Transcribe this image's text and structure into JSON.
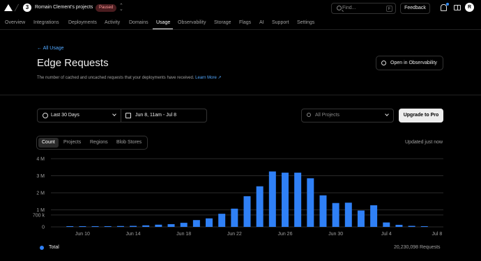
{
  "header": {
    "team_avatar": "3",
    "team_name": "Romain Clement's projects",
    "status_badge": "Paused",
    "search_placeholder": "Find...",
    "search_kbd": "F",
    "feedback_label": "Feedback",
    "user_initial": "R"
  },
  "tabs": [
    "Overview",
    "Integrations",
    "Deployments",
    "Activity",
    "Domains",
    "Usage",
    "Observability",
    "Storage",
    "Flags",
    "AI",
    "Support",
    "Settings"
  ],
  "active_tab": "Usage",
  "page": {
    "back_label": "All Usage",
    "title": "Edge Requests",
    "subtitle": "The number of cached and uncached requests that your deployments have received.",
    "learn_more": "Learn More",
    "observability_button": "Open in Observability"
  },
  "filters": {
    "range": "Last 30 Days",
    "date_range": "Jun 8, 11am - Jul 8",
    "projects_placeholder": "All Projects",
    "upgrade_label": "Upgrade to Pro"
  },
  "segments": {
    "items": [
      "Count",
      "Projects",
      "Regions",
      "Blob Stores"
    ],
    "active": "Count"
  },
  "updated_label": "Updated just now",
  "colors": {
    "accent": "#2f80f6",
    "link": "#52a8ff"
  },
  "chart_data": {
    "type": "bar",
    "ytick_labels": [
      "0",
      "700 k",
      "1 M",
      "2 M",
      "3 M",
      "4 M"
    ],
    "ytick_values": [
      0,
      700000,
      1000000,
      2000000,
      3000000,
      4000000
    ],
    "ylim": [
      0,
      4000000
    ],
    "xtick_labels": [
      "Jun 10",
      "Jun 14",
      "Jun 18",
      "Jun 22",
      "Jun 26",
      "Jun 30",
      "Jul 4",
      "Jul 8"
    ],
    "categories": [
      "Jun 8",
      "Jun 9",
      "Jun 10",
      "Jun 11",
      "Jun 12",
      "Jun 13",
      "Jun 14",
      "Jun 15",
      "Jun 16",
      "Jun 17",
      "Jun 18",
      "Jun 19",
      "Jun 20",
      "Jun 21",
      "Jun 22",
      "Jun 23",
      "Jun 24",
      "Jun 25",
      "Jun 26",
      "Jun 27",
      "Jun 28",
      "Jun 29",
      "Jun 30",
      "Jul 1",
      "Jul 2",
      "Jul 3",
      "Jul 4",
      "Jul 5",
      "Jul 6",
      "Jul 7",
      "Jul 8"
    ],
    "series": [
      {
        "name": "Total",
        "values": [
          0,
          10000,
          20000,
          30000,
          40000,
          50000,
          60000,
          90000,
          130000,
          160000,
          240000,
          400000,
          500000,
          770000,
          1070000,
          1800000,
          2380000,
          3250000,
          3180000,
          3180000,
          2850000,
          1850000,
          1400000,
          1420000,
          960000,
          1270000,
          260000,
          120000,
          60000,
          20000,
          0
        ]
      }
    ],
    "total_label": "Total",
    "total_value": "20,230,098 Requests",
    "grid": true
  }
}
